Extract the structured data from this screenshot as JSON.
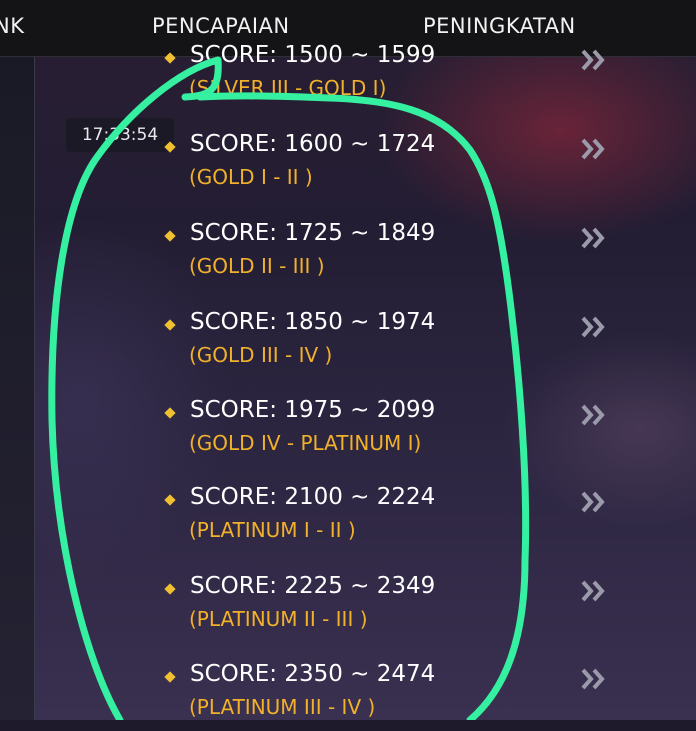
{
  "tabs": [
    {
      "label": "NK"
    },
    {
      "label": "PENCAPAIAN"
    },
    {
      "label": "PENINGKATAN"
    }
  ],
  "timestamp": "17:33:54",
  "tiers": [
    {
      "score": "SCORE: 1500 ~ 1599",
      "rank": "(SILVER III - GOLD I)"
    },
    {
      "score": "SCORE: 1600 ~ 1724",
      "rank": "(GOLD I - II )"
    },
    {
      "score": "SCORE: 1725 ~ 1849",
      "rank": "(GOLD II - III )"
    },
    {
      "score": "SCORE: 1850 ~ 1974",
      "rank": "(GOLD III - IV )"
    },
    {
      "score": "SCORE: 1975 ~ 2099",
      "rank": "(GOLD IV - PLATINUM I)"
    },
    {
      "score": "SCORE: 2100 ~ 2224",
      "rank": "(PLATINUM I - II )"
    },
    {
      "score": "SCORE: 2225 ~ 2349",
      "rank": "(PLATINUM II - III )"
    },
    {
      "score": "SCORE: 2350 ~ 2474",
      "rank": "(PLATINUM III - IV )"
    }
  ],
  "colors": {
    "score_text": "#ffffff",
    "rank_text": "#f2b12a",
    "bullet": "#f0c030",
    "annotation_stroke": "#35f0a0",
    "chevron": "#9a9aaa"
  },
  "icons": {
    "bullet": "diamond-bullet-icon",
    "row_action": "double-chevron-right-icon"
  }
}
